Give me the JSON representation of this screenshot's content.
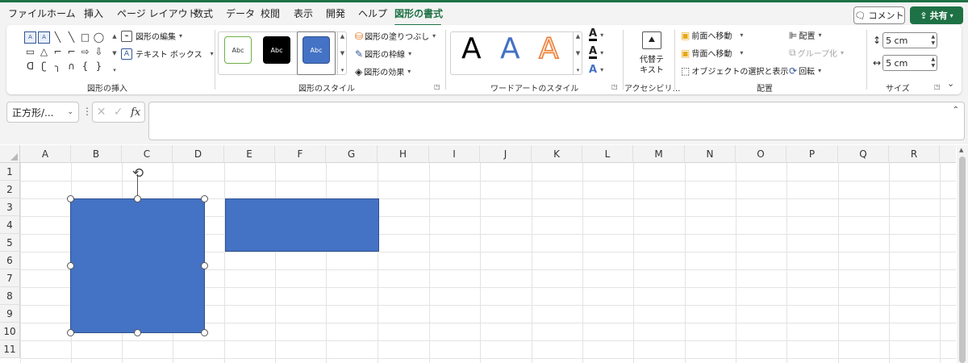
{
  "menu": [
    "ファイル",
    "ホーム",
    "挿入",
    "ページ レイアウト",
    "数式",
    "データ",
    "校閲",
    "表示",
    "開発",
    "ヘルプ",
    "図形の書式"
  ],
  "active_tab": "図形の書式",
  "comment_label": "コメント",
  "share_label": "共有",
  "groups": {
    "insert_shapes": {
      "label": "図形の挿入",
      "edit_shape": "図形の編集",
      "text_box": "テキスト ボックス"
    },
    "shape_styles": {
      "label": "図形のスタイル",
      "tiles": [
        "Abc",
        "Abc",
        "Abc"
      ],
      "fill": "図形の塗りつぶし",
      "outline": "図形の枠線",
      "effects": "図形の効果"
    },
    "wordart": {
      "label": "ワードアートのスタイル",
      "letters": [
        "A",
        "A",
        "A"
      ],
      "text_fill_icon": "A",
      "text_outline_icon": "A",
      "text_effects_icon": "A"
    },
    "accessibility": {
      "label": "アクセシビリ…",
      "alt_text_line1": "代替テ",
      "alt_text_line2": "キスト"
    },
    "arrange": {
      "label": "配置",
      "bring_forward": "前面へ移動",
      "send_backward": "背面へ移動",
      "selection_pane": "オブジェクトの選択と表示",
      "align": "配置",
      "group": "グループ化",
      "rotate": "回転"
    },
    "size": {
      "label": "サイズ",
      "height": "5 cm",
      "width": "5 cm"
    }
  },
  "formula_bar": {
    "name_box": "正方形/...",
    "fx": "fx",
    "cancel": "✕",
    "enter": "✓",
    "formula": ""
  },
  "columns": [
    "A",
    "B",
    "C",
    "D",
    "E",
    "F",
    "G",
    "H",
    "I",
    "J",
    "K",
    "L",
    "M",
    "N",
    "O",
    "P",
    "Q",
    "R"
  ],
  "rows": [
    "1",
    "2",
    "3",
    "4",
    "5",
    "6",
    "7",
    "8",
    "9",
    "10",
    "11"
  ],
  "colors": {
    "accent": "#1e7145",
    "shape_fill": "#4472c4",
    "shape_border": "#2f528f",
    "ribbon_bg": "#f3f3f3"
  }
}
